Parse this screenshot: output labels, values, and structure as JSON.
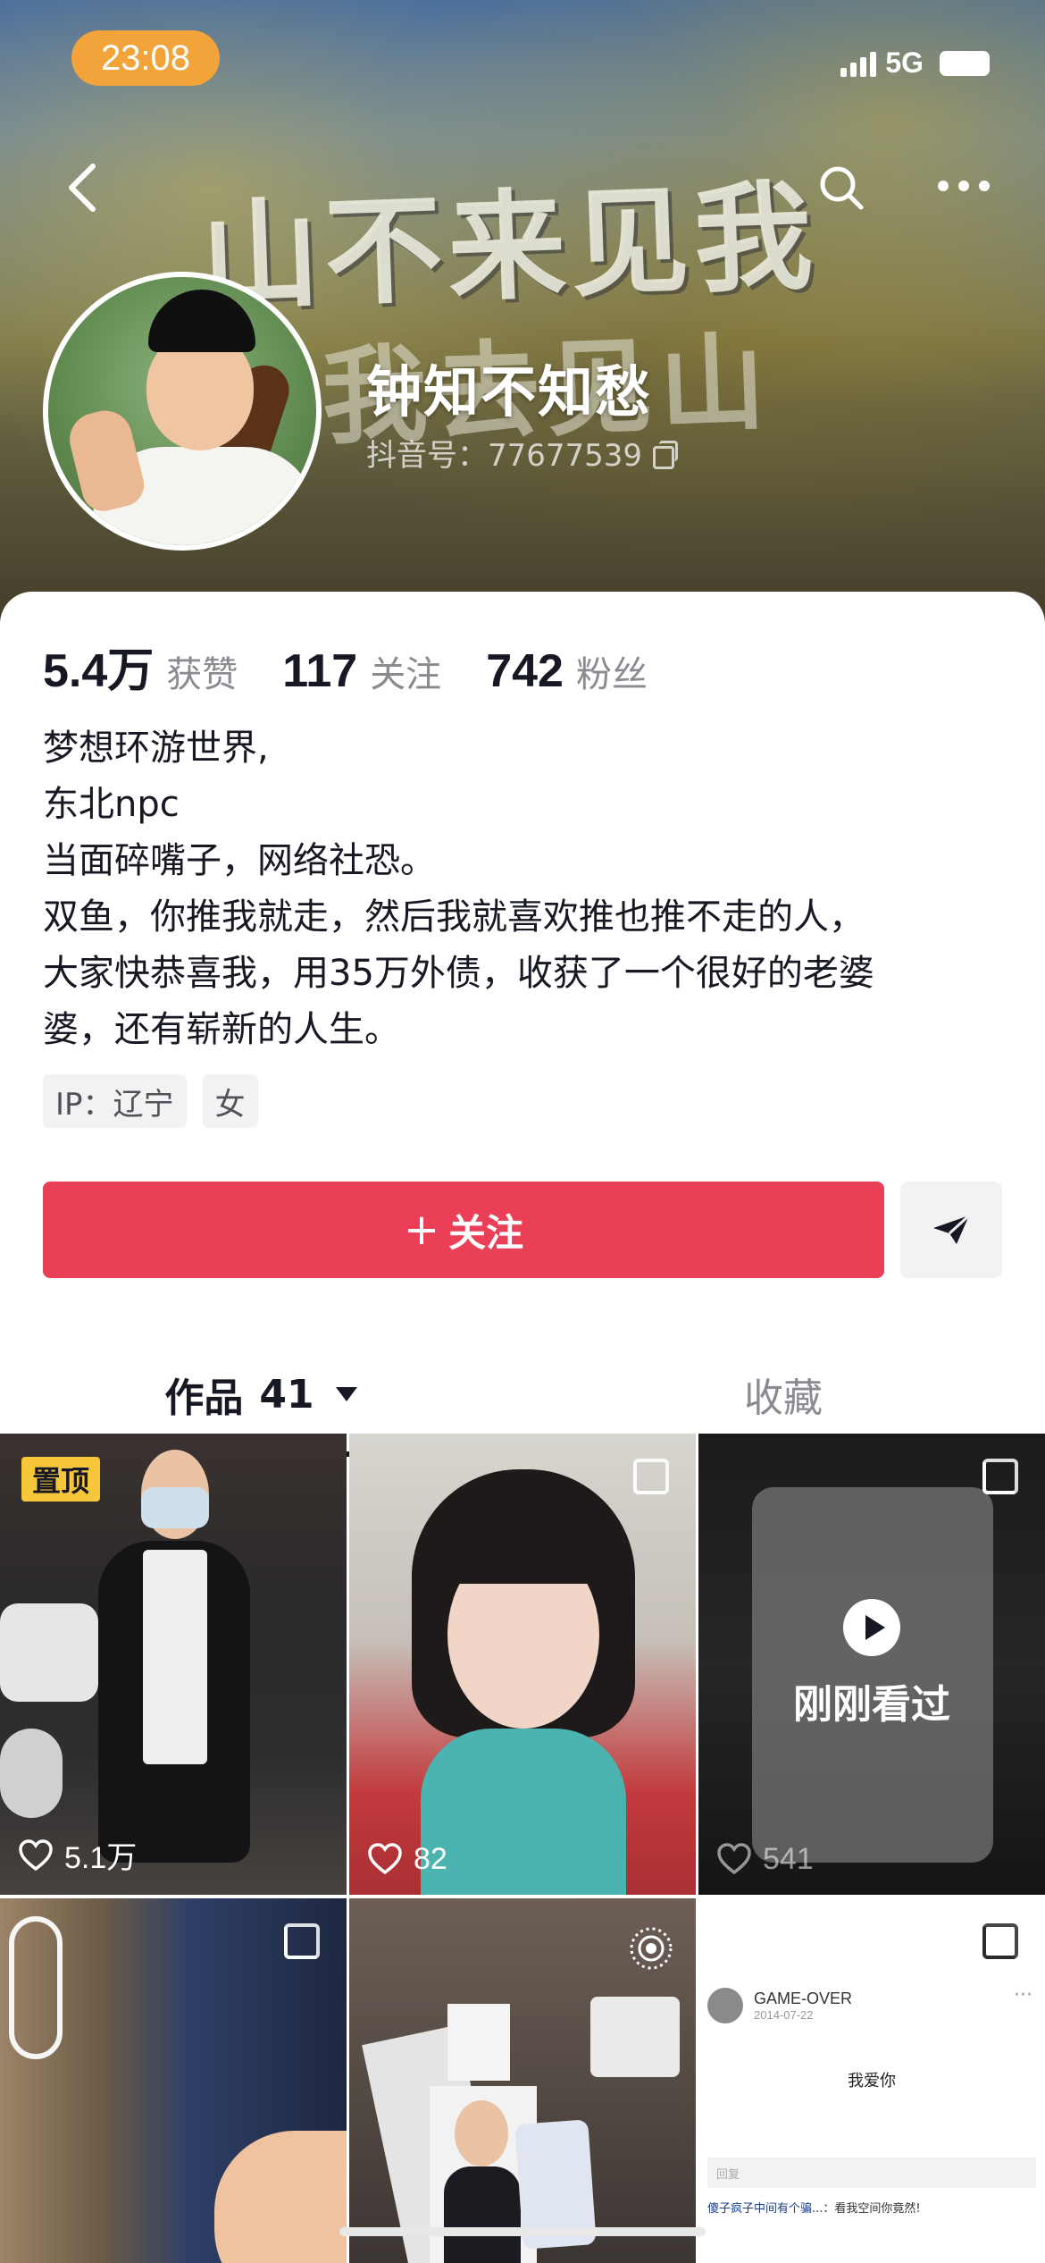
{
  "status_bar": {
    "time": "23:08",
    "network": "5G"
  },
  "cover": {
    "art_line1": "山不来见我",
    "art_line2": "我去见山"
  },
  "profile": {
    "name": "钟知不知愁",
    "account_label": "抖音号：77677539"
  },
  "stats": [
    {
      "value": "5.4万",
      "label": "获赞"
    },
    {
      "value": "117",
      "label": "关注"
    },
    {
      "value": "742",
      "label": "粉丝"
    }
  ],
  "bio": [
    "梦想环游世界,",
    "东北npc",
    "当面碎嘴子，网络社恐。",
    "双鱼，你推我就走，然后我就喜欢推也推不走的人，",
    "大家快恭喜我，用35万外债，收获了一个很好的老婆",
    "婆，还有崭新的人生。"
  ],
  "tags": [
    "IP：辽宁",
    "女"
  ],
  "actions": {
    "follow_label": "关注",
    "follow_plus": "+"
  },
  "tabs": {
    "works_label": "作品",
    "works_count": "41",
    "favorites_label": "收藏"
  },
  "videos": [
    {
      "pinned_label": "置顶",
      "likes": "5.1万"
    },
    {
      "likes": "82"
    },
    {
      "likes": "541",
      "recent_label": "刚刚看过"
    },
    {},
    {},
    {
      "note_user": "GAME-OVER",
      "note_date": "2014-07-22",
      "note_text": "我爱你",
      "note_reply_placeholder": "回复",
      "note_comment_user": "傻子疯子中间有个骗...",
      "note_comment_text": "：看我空间你竟然!"
    }
  ],
  "colors": {
    "accent": "#ea3f56",
    "pin": "#f6c73b",
    "status_time": "#f2a33a"
  }
}
